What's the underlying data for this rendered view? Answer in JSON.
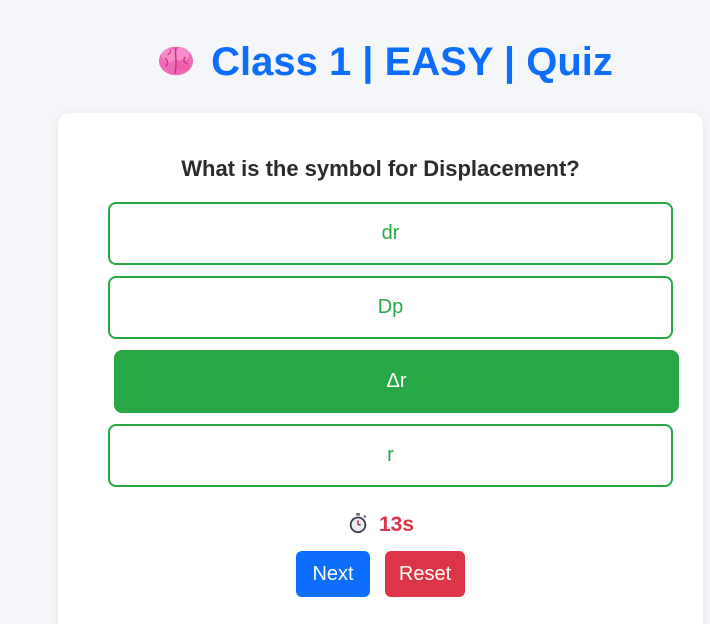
{
  "header": {
    "icon": "brain-icon",
    "title": "Class 1 | EASY | Quiz"
  },
  "quiz": {
    "question": "What is the symbol for Displacement?",
    "options": [
      "dr",
      "Dp",
      "Δr",
      "r"
    ],
    "selected_option": "Δr"
  },
  "timer": {
    "icon": "stopwatch-icon",
    "value": "13s"
  },
  "buttons": {
    "next_label": "Next",
    "reset_label": "Reset"
  },
  "colors": {
    "primary": "#0d6efd",
    "success": "#28a745",
    "danger": "#dc3545",
    "background": "#f4f6f9"
  }
}
